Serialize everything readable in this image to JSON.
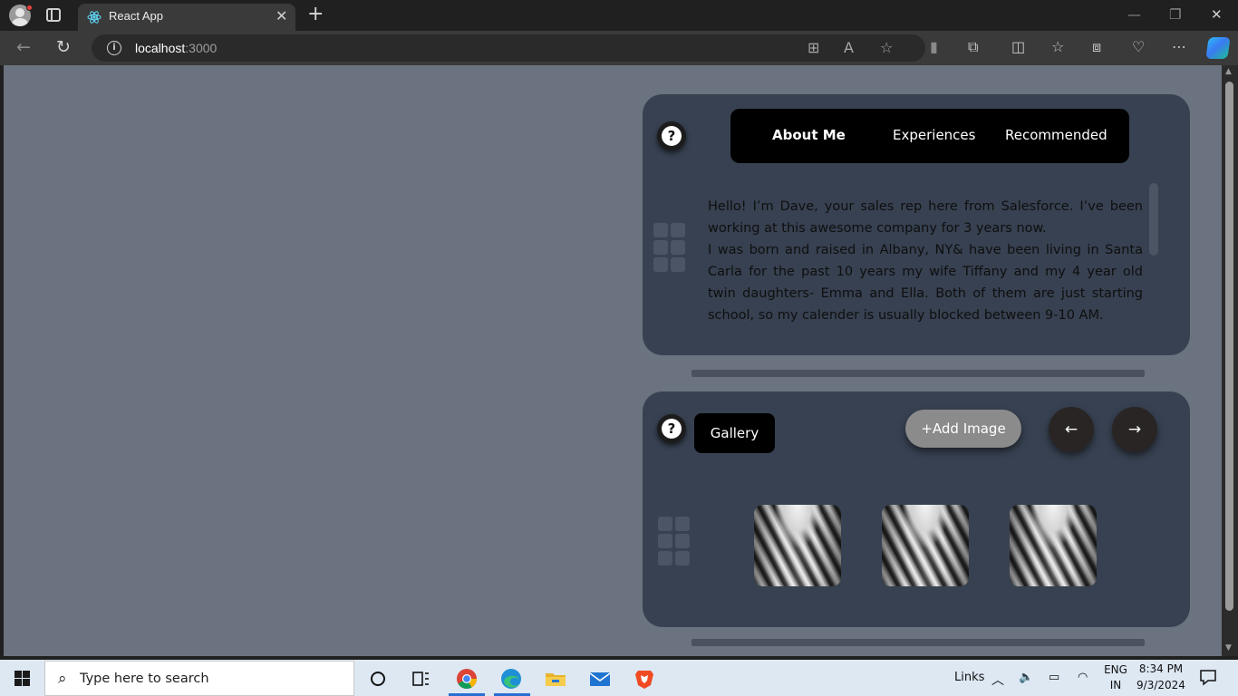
{
  "browser": {
    "tab_title": "React App",
    "url_host": "localhost",
    "url_port": ":3000",
    "icons": [
      "profile-icon",
      "tab-actions-icon",
      "react-favicon-icon",
      "close-tab-icon",
      "new-tab-icon",
      "minimize-icon",
      "restore-icon",
      "close-window-icon",
      "back-icon",
      "reload-icon",
      "site-info-icon",
      "app-available-icon",
      "read-aloud-icon",
      "favorite-star-icon",
      "extension-pin-icon",
      "extensions-icon",
      "split-screen-icon",
      "favorites-icon",
      "collections-icon",
      "browser-essentials-icon",
      "more-icon",
      "copilot-icon"
    ]
  },
  "about_card": {
    "tabs": [
      {
        "label": "About Me",
        "active": true
      },
      {
        "label": "Experiences",
        "active": false
      },
      {
        "label": "Recommended",
        "active": false
      }
    ],
    "paragraph_1": "Hello! I’m Dave, your sales rep here from Salesforce. I’ve been working at this awesome company for 3 years now.",
    "paragraph_2": "I was born and raised in Albany, NY& have been living in Santa Carla for the past 10 years my wife Tiffany and my 4 year old twin daughters- Emma and Ella. Both of them are just starting school, so my calender is usually blocked between 9-10 AM.",
    "help_glyph": "?"
  },
  "gallery_card": {
    "title": "Gallery",
    "add_button": "+Add Image",
    "prev_glyph": "←",
    "next_glyph": "→",
    "help_glyph": "?",
    "images": [
      "gallery-image-1",
      "gallery-image-2",
      "gallery-image-3"
    ]
  },
  "taskbar": {
    "search_placeholder": "Type here to search",
    "links_label": "Links",
    "language_top": "ENG",
    "language_bottom": "IN",
    "time": "8:34 PM",
    "date": "9/3/2024",
    "apps": [
      "cortana-icon",
      "task-view-icon",
      "chrome-icon",
      "edge-icon",
      "file-explorer-icon",
      "mail-icon",
      "brave-icon"
    ]
  },
  "colors": {
    "page_bg": "#6b7280",
    "card_bg": "#374151",
    "tab_strip_bg": "#000000",
    "add_button_bg": "#8b8b8b",
    "arrow_button_bg": "#292524"
  }
}
